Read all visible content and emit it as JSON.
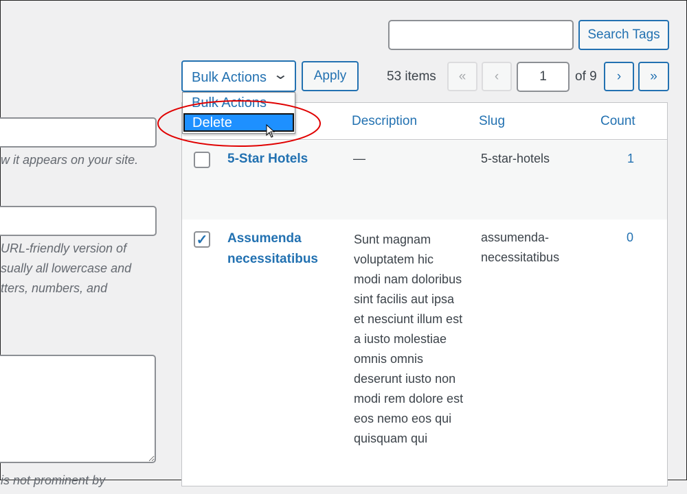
{
  "search": {
    "value": "",
    "button": "Search Tags"
  },
  "bulk": {
    "selected": "Bulk Actions",
    "apply": "Apply",
    "options": [
      "Bulk Actions",
      "Delete"
    ],
    "highlighted": "Delete"
  },
  "pagination": {
    "items": "53 items",
    "first": "«",
    "prev": "‹",
    "page": "1",
    "of": "of 9",
    "next": "›",
    "last": "»"
  },
  "form": {
    "name_help": "w it appears on your site.",
    "slug_help": [
      " URL-friendly version of",
      "sually all lowercase and",
      "tters, numbers, and"
    ],
    "desc_help": "is not prominent by"
  },
  "table": {
    "headers": {
      "description": "Description",
      "slug": "Slug",
      "count": "Count"
    },
    "rows": [
      {
        "name": "5-Star Hotels",
        "description": "—",
        "slug": "5-star-hotels",
        "count": "1",
        "checked": false
      },
      {
        "name": "Assumenda necessitatibus",
        "description": "Sunt magnam voluptatem hic modi nam doloribus sint facilis aut ipsa et nesciunt illum est a iusto molestiae omnis omnis deserunt iusto non modi rem dolore est eos nemo eos qui quisquam qui",
        "slug": "assumenda-necessitatibus",
        "count": "0",
        "checked": true
      }
    ]
  },
  "colors": {
    "accent": "#2271b1",
    "highlight": "#1e90ff",
    "annotation": "#e00000"
  }
}
